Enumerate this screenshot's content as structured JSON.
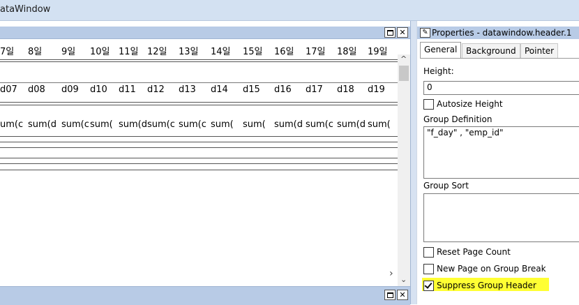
{
  "window": {
    "title": "ataWindow"
  },
  "datawindow": {
    "header_days": [
      "7일",
      "8일",
      "9일",
      "10일",
      "11일",
      "12일",
      "13일",
      "14일",
      "15일",
      "16일",
      "17일",
      "18일",
      "19일"
    ],
    "detail_cols": [
      "d07",
      "d08",
      "d09",
      "d10",
      "d11",
      "d12",
      "d13",
      "d14",
      "d15",
      "d16",
      "d17",
      "d18",
      "d19"
    ],
    "sum_cols": [
      "um(c",
      "sum(d",
      "sum(c",
      "sum(",
      "sum(d",
      "sum(c",
      "sum(c",
      "sum(",
      "sum(",
      "sum(d",
      "sum(c",
      "sum(d",
      "sum("
    ]
  },
  "properties": {
    "title": "Properties - datawindow.header.1",
    "tabs": [
      "General",
      "Background",
      "Pointer"
    ],
    "height_label": "Height:",
    "height_value": "0",
    "autosize_label": "Autosize Height",
    "group_def_label": "Group Definition",
    "group_def_value": "\"f_day\" , \"emp_id\"",
    "group_sort_label": "Group Sort",
    "reset_page_count": {
      "label": "Reset Page Count",
      "checked": false
    },
    "new_page_on_break": {
      "label": "New Page on Group Break",
      "checked": false
    },
    "suppress_group_header": {
      "label": "Suppress Group Header",
      "checked": true
    },
    "highlight_color": "#ffff33"
  }
}
